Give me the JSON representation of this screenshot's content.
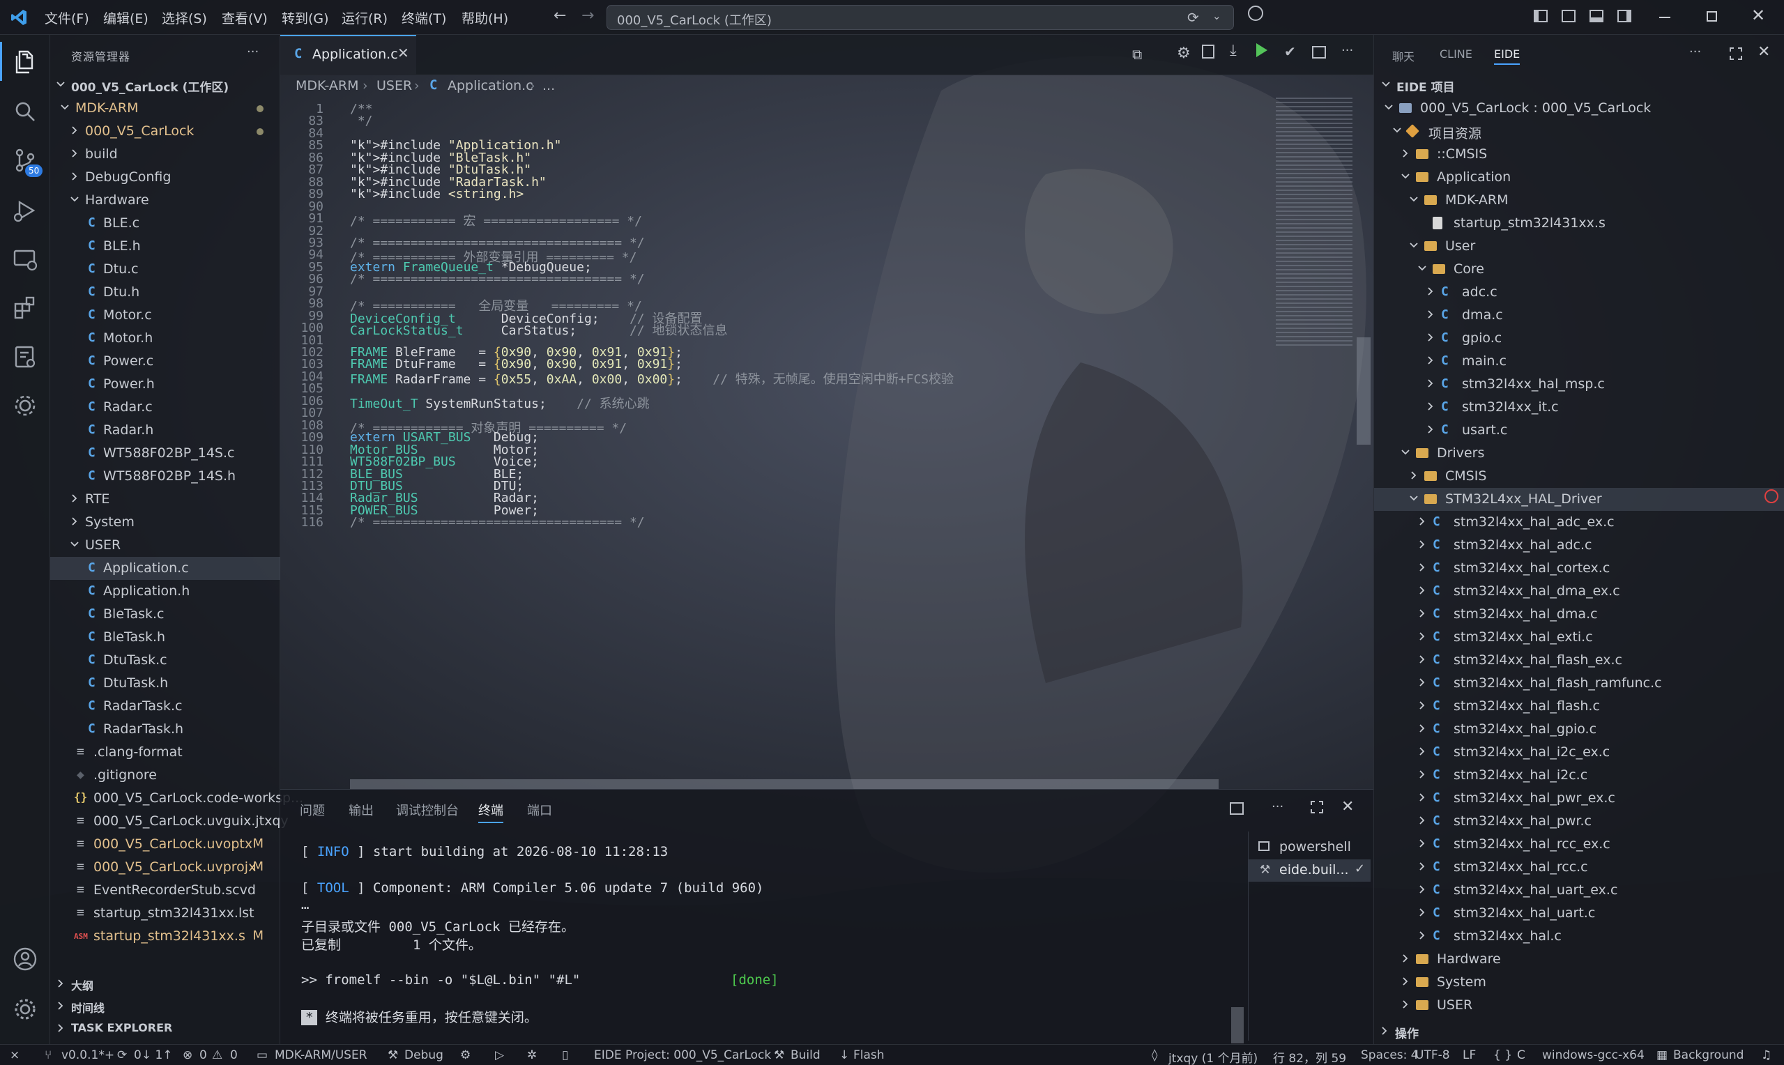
{
  "menu": [
    "文件(F)",
    "编辑(E)",
    "选择(S)",
    "查看(V)",
    "转到(G)",
    "运行(R)",
    "终端(T)",
    "帮助(H)"
  ],
  "command_center": "000_V5_CarLock (工作区)",
  "activity": {
    "source_control_badge": "50"
  },
  "explorer": {
    "title": "资源管理器",
    "workspace": "000_V5_CarLock (工作区)",
    "rows": [
      {
        "label": "MDK-ARM",
        "kind": "folder-open",
        "depth": 0,
        "mod": true,
        "dot": true
      },
      {
        "label": "000_V5_CarLock",
        "kind": "folder",
        "depth": 1,
        "mod": true,
        "dot": true
      },
      {
        "label": "build",
        "kind": "folder",
        "depth": 1
      },
      {
        "label": "DebugConfig",
        "kind": "folder",
        "depth": 1
      },
      {
        "label": "Hardware",
        "kind": "folder-open",
        "depth": 1
      },
      {
        "label": "BLE.c",
        "kind": "c",
        "depth": 2
      },
      {
        "label": "BLE.h",
        "kind": "c",
        "depth": 2
      },
      {
        "label": "Dtu.c",
        "kind": "c",
        "depth": 2
      },
      {
        "label": "Dtu.h",
        "kind": "c",
        "depth": 2
      },
      {
        "label": "Motor.c",
        "kind": "c",
        "depth": 2
      },
      {
        "label": "Motor.h",
        "kind": "c",
        "depth": 2
      },
      {
        "label": "Power.c",
        "kind": "c",
        "depth": 2
      },
      {
        "label": "Power.h",
        "kind": "c",
        "depth": 2
      },
      {
        "label": "Radar.c",
        "kind": "c",
        "depth": 2
      },
      {
        "label": "Radar.h",
        "kind": "c",
        "depth": 2
      },
      {
        "label": "WT588F02BP_14S.c",
        "kind": "c",
        "depth": 2
      },
      {
        "label": "WT588F02BP_14S.h",
        "kind": "c",
        "depth": 2
      },
      {
        "label": "RTE",
        "kind": "folder",
        "depth": 1
      },
      {
        "label": "System",
        "kind": "folder",
        "depth": 1
      },
      {
        "label": "USER",
        "kind": "folder-open",
        "depth": 1
      },
      {
        "label": "Application.c",
        "kind": "c",
        "depth": 2,
        "selected": true
      },
      {
        "label": "Application.h",
        "kind": "c",
        "depth": 2
      },
      {
        "label": "BleTask.c",
        "kind": "c",
        "depth": 2
      },
      {
        "label": "BleTask.h",
        "kind": "c",
        "depth": 2
      },
      {
        "label": "DtuTask.c",
        "kind": "c",
        "depth": 2
      },
      {
        "label": "DtuTask.h",
        "kind": "c",
        "depth": 2
      },
      {
        "label": "RadarTask.c",
        "kind": "c",
        "depth": 2
      },
      {
        "label": "RadarTask.h",
        "kind": "c",
        "depth": 2
      },
      {
        "label": ".clang-format",
        "kind": "lines",
        "depth": 1
      },
      {
        "label": ".gitignore",
        "kind": "diamond",
        "depth": 1
      },
      {
        "label": "000_V5_CarLock.code-worksp...",
        "kind": "braces",
        "depth": 1
      },
      {
        "label": "000_V5_CarLock.uvguix.jtxqy",
        "kind": "lines",
        "depth": 1
      },
      {
        "label": "000_V5_CarLock.uvoptx",
        "kind": "lines",
        "depth": 1,
        "mod": true,
        "badge": "M"
      },
      {
        "label": "000_V5_CarLock.uvprojx",
        "kind": "lines",
        "depth": 1,
        "mod": true,
        "badge": "M"
      },
      {
        "label": "EventRecorderStub.scvd",
        "kind": "lines",
        "depth": 1
      },
      {
        "label": "startup_stm32l431xx.lst",
        "kind": "lines",
        "depth": 1
      },
      {
        "label": "startup_stm32l431xx.s",
        "kind": "asm",
        "depth": 1,
        "mod": true,
        "badge": "M"
      }
    ],
    "sections": [
      "大纲",
      "时间线",
      "TASK EXPLORER"
    ]
  },
  "editor": {
    "tab_label": "Application.c",
    "breadcrumb": [
      "MDK-ARM",
      "USER",
      "Application.c",
      "..."
    ],
    "lines": [
      {
        "n": "1",
        "t": "/**"
      },
      {
        "n": "83",
        "t": " */"
      },
      {
        "n": "84",
        "t": ""
      },
      {
        "n": "85",
        "t": "#include \"Application.h\""
      },
      {
        "n": "86",
        "t": "#include \"BleTask.h\""
      },
      {
        "n": "87",
        "t": "#include \"DtuTask.h\""
      },
      {
        "n": "88",
        "t": "#include \"RadarTask.h\""
      },
      {
        "n": "89",
        "t": "#include <string.h>"
      },
      {
        "n": "90",
        "t": ""
      },
      {
        "n": "91",
        "t": "/* =========== 宏 ================== */"
      },
      {
        "n": "92",
        "t": ""
      },
      {
        "n": "93",
        "t": "/* ================================= */"
      },
      {
        "n": "94",
        "t": "/* =========== 外部变量引用 ========= */"
      },
      {
        "n": "95",
        "t": "extern FrameQueue_t *DebugQueue;"
      },
      {
        "n": "96",
        "t": "/* ================================= */"
      },
      {
        "n": "97",
        "t": ""
      },
      {
        "n": "98",
        "t": "/* ===========   全局变量   ========= */"
      },
      {
        "n": "99",
        "t": "DeviceConfig_t      DeviceConfig;    // 设备配置"
      },
      {
        "n": "100",
        "t": "CarLockStatus_t     CarStatus;       // 地锁状态信息"
      },
      {
        "n": "101",
        "t": ""
      },
      {
        "n": "102",
        "t": "FRAME BleFrame   = {0x90, 0x90, 0x91, 0x91};"
      },
      {
        "n": "103",
        "t": "FRAME DtuFrame   = {0x90, 0x90, 0x91, 0x91};"
      },
      {
        "n": "104",
        "t": "FRAME RadarFrame = {0x55, 0xAA, 0x00, 0x00};    // 特殊，无帧尾。使用空闲中断+FCS校验"
      },
      {
        "n": "105",
        "t": ""
      },
      {
        "n": "106",
        "t": "TimeOut_T SystemRunStatus;    // 系统心跳"
      },
      {
        "n": "107",
        "t": ""
      },
      {
        "n": "108",
        "t": "/* ============ 对象声明 ========== */"
      },
      {
        "n": "109",
        "t": "extern USART_BUS   Debug;"
      },
      {
        "n": "110",
        "t": "Motor_BUS          Motor;"
      },
      {
        "n": "111",
        "t": "WT588F02BP_BUS     Voice;"
      },
      {
        "n": "112",
        "t": "BLE_BUS            BLE;"
      },
      {
        "n": "113",
        "t": "DTU_BUS            DTU;"
      },
      {
        "n": "114",
        "t": "Radar_BUS          Radar;"
      },
      {
        "n": "115",
        "t": "POWER_BUS          Power;"
      },
      {
        "n": "116",
        "t": "/* ================================= */"
      }
    ]
  },
  "panel": {
    "tabs": [
      "问题",
      "输出",
      "调试控制台",
      "终端",
      "端口"
    ],
    "active_tab": "终端",
    "terminal": {
      "info_tag": "INFO",
      "info_text": "start building at 2026-08-10 11:28:13",
      "tool_tag": "TOOL",
      "tool_text": "Component: ARM Compiler 5.06 update 7 (build 960)",
      "ellipsis": "…",
      "line_dir": "子目录或文件 000_V5_CarLock 已经存在。",
      "line_copied": "已复制         1 个文件。",
      "cmd": ">> fromelf --bin -o \"$L@L.bin\" \"#L\"",
      "done": "[done]",
      "reuse": "终端将被任务重用，按任意键关闭。"
    },
    "terminals": [
      "powershell",
      "eide.buil..."
    ]
  },
  "right": {
    "tabs": [
      "聊天",
      "CLINE",
      "EIDE"
    ],
    "active_tab": "EIDE",
    "section": "EIDE 项目",
    "rows": [
      {
        "label": "000_V5_CarLock : 000_V5_CarLock",
        "kind": "project",
        "depth": 0,
        "open": true
      },
      {
        "label": "项目资源",
        "kind": "res",
        "depth": 1,
        "open": true
      },
      {
        "label": "::CMSIS",
        "kind": "folder",
        "depth": 2
      },
      {
        "label": "Application",
        "kind": "folder",
        "depth": 2,
        "open": true
      },
      {
        "label": "MDK-ARM",
        "kind": "folder",
        "depth": 3,
        "open": true
      },
      {
        "label": "startup_stm32l431xx.s",
        "kind": "file",
        "depth": 4,
        "nochev": true
      },
      {
        "label": "User",
        "kind": "folder",
        "depth": 3,
        "open": true
      },
      {
        "label": "Core",
        "kind": "folder",
        "depth": 4,
        "open": true
      },
      {
        "label": "adc.c",
        "kind": "c",
        "depth": 5
      },
      {
        "label": "dma.c",
        "kind": "c",
        "depth": 5
      },
      {
        "label": "gpio.c",
        "kind": "c",
        "depth": 5
      },
      {
        "label": "main.c",
        "kind": "c",
        "depth": 5
      },
      {
        "label": "stm32l4xx_hal_msp.c",
        "kind": "c",
        "depth": 5
      },
      {
        "label": "stm32l4xx_it.c",
        "kind": "c",
        "depth": 5
      },
      {
        "label": "usart.c",
        "kind": "c",
        "depth": 5
      },
      {
        "label": "Drivers",
        "kind": "folder",
        "depth": 2,
        "open": true
      },
      {
        "label": "CMSIS",
        "kind": "folder",
        "depth": 3
      },
      {
        "label": "STM32L4xx_HAL_Driver",
        "kind": "folder",
        "depth": 3,
        "open": true,
        "selected": true
      },
      {
        "label": "stm32l4xx_hal_adc_ex.c",
        "kind": "c",
        "depth": 4
      },
      {
        "label": "stm32l4xx_hal_adc.c",
        "kind": "c",
        "depth": 4
      },
      {
        "label": "stm32l4xx_hal_cortex.c",
        "kind": "c",
        "depth": 4
      },
      {
        "label": "stm32l4xx_hal_dma_ex.c",
        "kind": "c",
        "depth": 4
      },
      {
        "label": "stm32l4xx_hal_dma.c",
        "kind": "c",
        "depth": 4
      },
      {
        "label": "stm32l4xx_hal_exti.c",
        "kind": "c",
        "depth": 4
      },
      {
        "label": "stm32l4xx_hal_flash_ex.c",
        "kind": "c",
        "depth": 4
      },
      {
        "label": "stm32l4xx_hal_flash_ramfunc.c",
        "kind": "c",
        "depth": 4
      },
      {
        "label": "stm32l4xx_hal_flash.c",
        "kind": "c",
        "depth": 4
      },
      {
        "label": "stm32l4xx_hal_gpio.c",
        "kind": "c",
        "depth": 4
      },
      {
        "label": "stm32l4xx_hal_i2c_ex.c",
        "kind": "c",
        "depth": 4
      },
      {
        "label": "stm32l4xx_hal_i2c.c",
        "kind": "c",
        "depth": 4
      },
      {
        "label": "stm32l4xx_hal_pwr_ex.c",
        "kind": "c",
        "depth": 4
      },
      {
        "label": "stm32l4xx_hal_pwr.c",
        "kind": "c",
        "depth": 4
      },
      {
        "label": "stm32l4xx_hal_rcc_ex.c",
        "kind": "c",
        "depth": 4
      },
      {
        "label": "stm32l4xx_hal_rcc.c",
        "kind": "c",
        "depth": 4
      },
      {
        "label": "stm32l4xx_hal_uart_ex.c",
        "kind": "c",
        "depth": 4
      },
      {
        "label": "stm32l4xx_hal_uart.c",
        "kind": "c",
        "depth": 4
      },
      {
        "label": "stm32l4xx_hal.c",
        "kind": "c",
        "depth": 4
      },
      {
        "label": "Hardware",
        "kind": "folder",
        "depth": 2
      },
      {
        "label": "System",
        "kind": "folder",
        "depth": 2
      },
      {
        "label": "USER",
        "kind": "folder",
        "depth": 2
      }
    ],
    "bottom_section": "操作"
  },
  "statusbar": {
    "version": "v0.0.1*+",
    "sync": "0↓ 1↑",
    "errors": "0",
    "warnings": "0",
    "path": "MDK-ARM/USER",
    "debug": "Debug",
    "eide_project": "EIDE Project: 000_V5_CarLock",
    "build": "Build",
    "flash": "Flash",
    "blame": "jtxqy (1 个月前)",
    "position": "行 82，列 59",
    "spaces": "Spaces: 4",
    "encoding": "UTF-8",
    "eol": "LF",
    "language": "C",
    "platform": "windows-gcc-x64",
    "background": "Background"
  },
  "colors": {
    "accent": "#4aa3ff",
    "modified": "#e2c08d",
    "c_icon": "#5aa6e8",
    "folder": "#d9a950",
    "done": "#4ec94e"
  }
}
